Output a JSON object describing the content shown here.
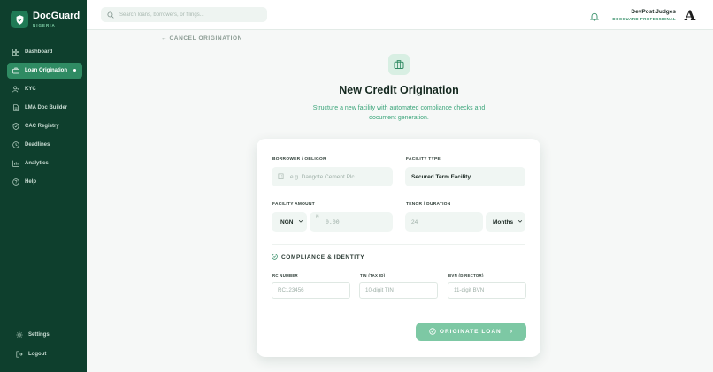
{
  "brand": {
    "name": "DocGuard",
    "sub": "NIGERIA"
  },
  "sidebar": {
    "items": [
      {
        "label": "Dashboard",
        "icon": "dashboard-icon"
      },
      {
        "label": "Loan Origination",
        "icon": "briefcase-icon",
        "active": true
      },
      {
        "label": "KYC",
        "icon": "user-check-icon"
      },
      {
        "label": "LMA Doc Builder",
        "icon": "document-icon"
      },
      {
        "label": "CAC Registry",
        "icon": "shield-check-icon"
      },
      {
        "label": "Deadlines",
        "icon": "clock-icon"
      },
      {
        "label": "Analytics",
        "icon": "chart-icon"
      },
      {
        "label": "Help",
        "icon": "help-icon"
      }
    ],
    "bottom": [
      {
        "label": "Settings",
        "icon": "gear-icon"
      },
      {
        "label": "Logout",
        "icon": "logout-icon"
      }
    ]
  },
  "header": {
    "search_placeholder": "Search loans, borrowers, or filings...",
    "user_name": "DevPost Judges",
    "user_role": "DOCGUARD PROFESSIONAL",
    "avatar_letter": "A"
  },
  "main": {
    "cancel": "← CANCEL ORIGINATION",
    "title": "New Credit Origination",
    "subtitle": "Structure a new facility with automated compliance checks and document generation."
  },
  "form": {
    "borrower_label": "BORROWER / OBLIGOR",
    "borrower_placeholder": "e.g. Dangote Cement Plc",
    "facility_type_label": "FACILITY TYPE",
    "facility_type_value": "Secured Term Facility",
    "amount_label": "FACILITY AMOUNT",
    "currency_value": "NGN",
    "currency_symbol": "₦",
    "amount_placeholder": "0.00",
    "tenor_label": "TENOR / DURATION",
    "tenor_placeholder": "24",
    "tenor_unit": "Months",
    "section_title": "COMPLIANCE & IDENTITY",
    "rc_label": "RC NUMBER",
    "rc_placeholder": "RC123456",
    "tin_label": "TIN (TAX ID)",
    "tin_placeholder": "10-digit TIN",
    "bvn_label": "BVN (DIRECTOR)",
    "bvn_placeholder": "11-digit BVN",
    "submit_label": "ORIGINATE LOAN",
    "submit_arrow": "›"
  },
  "colors": {
    "sidebar": "#0e3f2d",
    "accent": "#2f8b63",
    "button": "#7dc8a4"
  }
}
